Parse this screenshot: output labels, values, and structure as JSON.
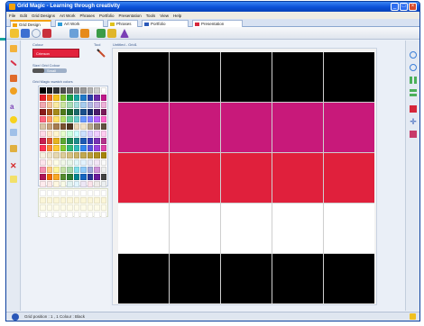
{
  "window": {
    "title": "Grid Magic - Learning through creativity",
    "minimize": "_",
    "maximize": "□",
    "close": "×"
  },
  "menu": [
    "File",
    "Edit",
    "Grid Designs",
    "Art Work",
    "Phrases",
    "Portfolio",
    "Presentation",
    "Tools",
    "View",
    "Help"
  ],
  "tabs": [
    {
      "label": "Grid Design",
      "color": "#f3a20b"
    },
    {
      "label": "Art Work",
      "color": "#2e9bd6"
    },
    {
      "label": "Phrases",
      "color": "#e0c21c"
    },
    {
      "label": "Portfolio",
      "color": "#2a58b8"
    },
    {
      "label": "Presentation",
      "color": "#d6263a"
    }
  ],
  "panel": {
    "colour_label": "Colour",
    "colour_value": "Crimson",
    "tool_label": "Tool",
    "size_label": "Size/ Grid Colour",
    "slider_value": "Small",
    "slider_fraction": 0.35,
    "palette_label": "Grid Magic swatch colors"
  },
  "canvas": {
    "title": "Untitled - Grid1",
    "rows": [
      [
        "#000000",
        "#000000",
        "#000000",
        "#000000",
        "#000000"
      ],
      [
        "#c8197a",
        "#c8197a",
        "#c8197a",
        "#c8197a",
        "#c8197a"
      ],
      [
        "#e0203c",
        "#e0203c",
        "#e0203c",
        "#e0203c",
        "#e0203c"
      ],
      [
        "#ffffff",
        "#ffffff",
        "#ffffff",
        "#ffffff",
        "#ffffff"
      ],
      [
        "#000000",
        "#000000",
        "#000000",
        "#000000",
        "#000000"
      ]
    ]
  },
  "palette_colors": [
    "#000000",
    "#1a1a1a",
    "#333333",
    "#4d4d4d",
    "#666666",
    "#808080",
    "#999999",
    "#b3b3b3",
    "#cccccc",
    "#ffffff",
    "#e51f2b",
    "#f26b1d",
    "#f7c21a",
    "#7fbf2a",
    "#1aa04a",
    "#17a3a0",
    "#1f78c8",
    "#2a3ea8",
    "#6a2aa8",
    "#c0198a",
    "#f2a7b0",
    "#f7c49a",
    "#faeaa0",
    "#cbe6a0",
    "#a6dcb4",
    "#a2dede",
    "#a8ccee",
    "#b0b6e4",
    "#c8aee4",
    "#eeb0d8",
    "#8b1a1a",
    "#a6521a",
    "#a68a1a",
    "#4f7a1a",
    "#1a6a33",
    "#1a6a6a",
    "#1a4f8b",
    "#1a2a6a",
    "#4a1a6a",
    "#7a1a5a",
    "#ff6680",
    "#ff9966",
    "#ffe066",
    "#b3e066",
    "#66cc99",
    "#66cccc",
    "#6699ff",
    "#8080ff",
    "#b366ff",
    "#ff66cc",
    "#d9c3a5",
    "#c8a27a",
    "#a67b4f",
    "#7a5230",
    "#4f3520",
    "#e8d6b8",
    "#f0e2c8",
    "#b8a88a",
    "#908070",
    "#605040",
    "#ffd9e6",
    "#ffe6cc",
    "#fff5cc",
    "#e6ffcc",
    "#ccffe0",
    "#ccffff",
    "#cce0ff",
    "#d9ccff",
    "#f0ccff",
    "#ffccf0",
    "#c81e50",
    "#e05a32",
    "#e6b41e",
    "#5aa832",
    "#1e8c5a",
    "#1e8c8c",
    "#1e5ab4",
    "#3c3cb4",
    "#7832b4",
    "#b4328c",
    "#ff3355",
    "#ff8833",
    "#ffcc33",
    "#88cc33",
    "#33bb77",
    "#33bbbb",
    "#3388ee",
    "#5555dd",
    "#9944dd",
    "#dd44aa",
    "#f7f0e0",
    "#efe4c8",
    "#e6d8b0",
    "#ddcc98",
    "#d4c080",
    "#cbb468",
    "#c2a850",
    "#b99c38",
    "#b09020",
    "#a78408",
    "#fce4ec",
    "#fff3e0",
    "#fffde7",
    "#f1f8e9",
    "#e8f5e9",
    "#e0f7fa",
    "#e3f2fd",
    "#e8eaf6",
    "#f3e5f5",
    "#fafafa",
    "#f48fb1",
    "#ffcc80",
    "#fff59d",
    "#c5e1a5",
    "#a5d6a7",
    "#80deea",
    "#90caf9",
    "#9fa8da",
    "#ce93d8",
    "#eeeeee",
    "#ad1457",
    "#ef6c00",
    "#f9a825",
    "#558b2f",
    "#2e7d32",
    "#00838f",
    "#1565c0",
    "#283593",
    "#6a1b9a",
    "#424242",
    "#ffebee",
    "#fbe9e7",
    "#fff8e1",
    "#f9fbe7",
    "#e0f2f1",
    "#e1f5fe",
    "#ede7f6",
    "#fce4ec",
    "#efebe9",
    "#eceff1"
  ],
  "palette_lower_colors": [
    "#ffffff",
    "#ffffff",
    "#ffffff",
    "#ffffff",
    "#ffffff",
    "#ffffff",
    "#ffffff",
    "#ffffff",
    "#ffffff",
    "#ffffff",
    "#fbf6d8",
    "#fbf6d8",
    "#fbf6d8",
    "#fbf6d8",
    "#fbf6d8",
    "#fbf6d8",
    "#fbf6d8",
    "#fbf6d8",
    "#fbf6d8",
    "#fbf6d8",
    "#fdfbe8",
    "#fdfbe8",
    "#fdfbe8",
    "#fdfbe8",
    "#fdfbe8",
    "#fdfbe8",
    "#fdfbe8",
    "#fdfbe8",
    "#fdfbe8",
    "#fdfbe8",
    "#ffffff",
    "#ffffff",
    "#ffffff",
    "#ffffff",
    "#ffffff",
    "#ffffff",
    "#ffffff",
    "#ffffff",
    "#ffffff",
    "#ffffff"
  ],
  "status": {
    "text": "Grid position : 1 , 1  Colour : Black"
  },
  "accent": "#14a39a"
}
